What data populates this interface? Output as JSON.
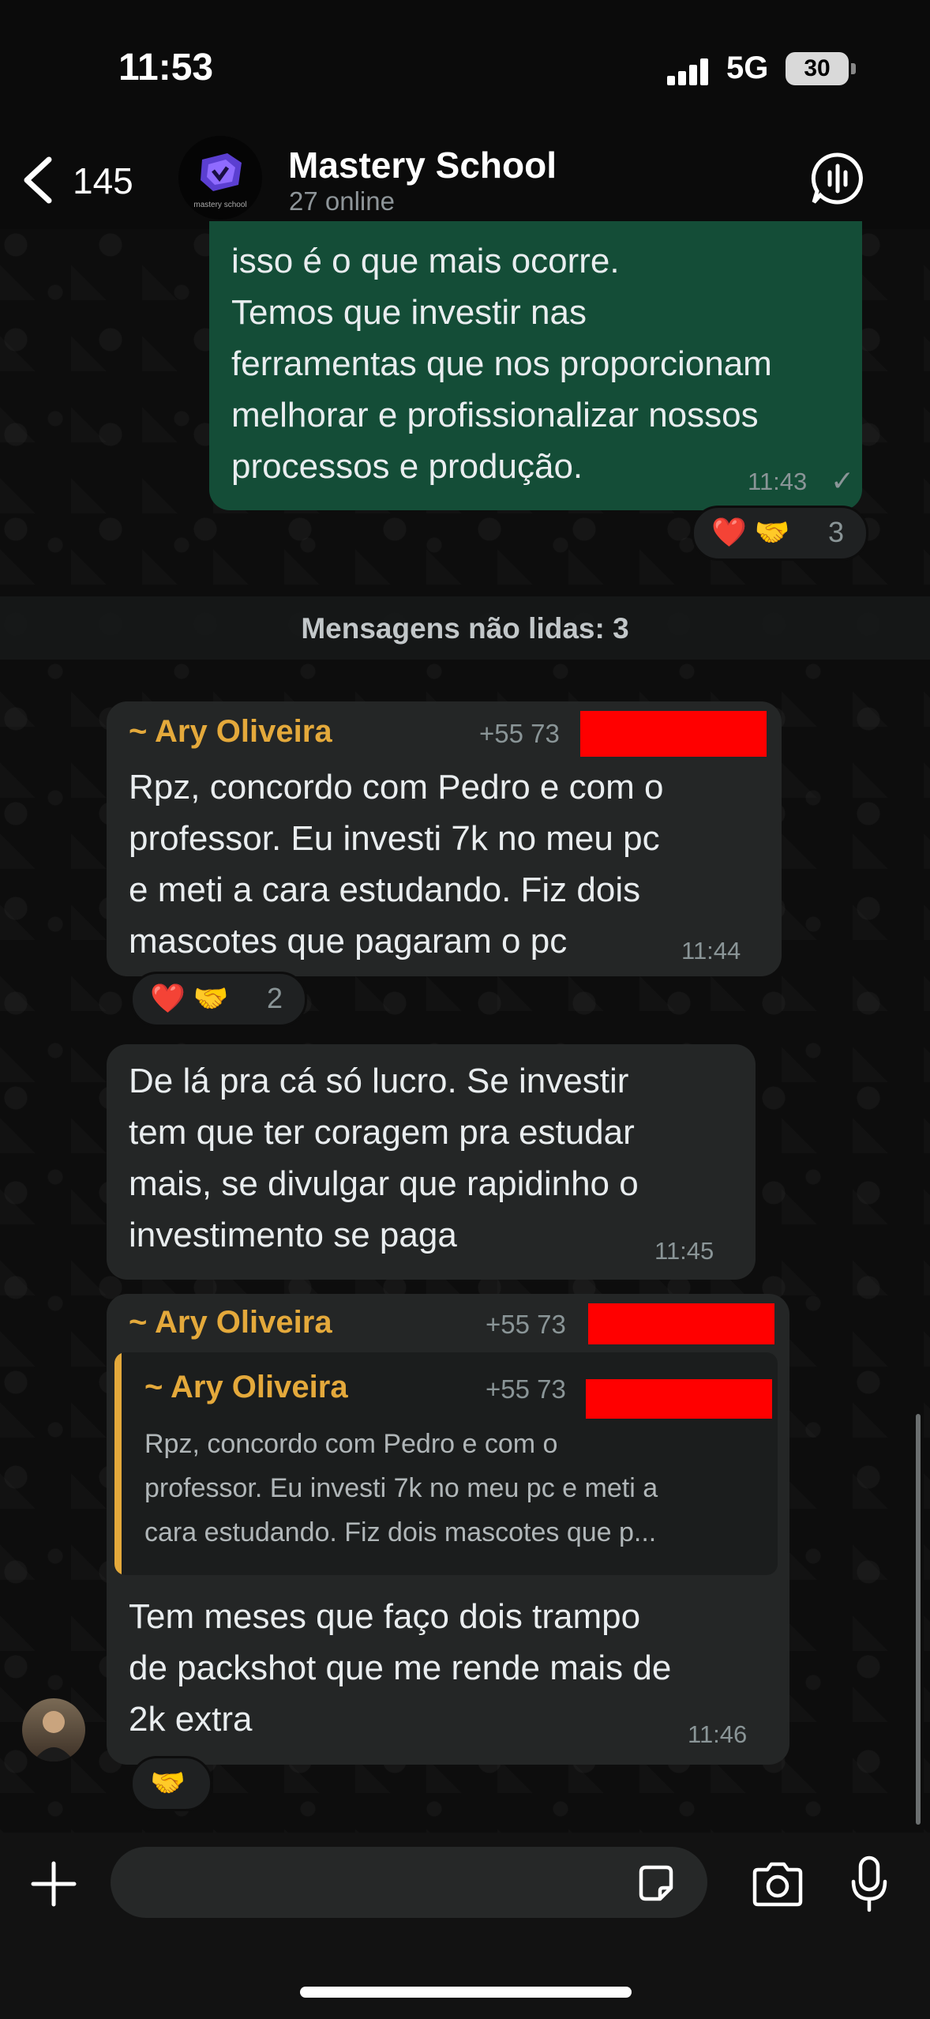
{
  "status_bar": {
    "time": "11:53",
    "network": "5G",
    "battery": "30"
  },
  "header": {
    "back_count": "145",
    "title": "Mastery School",
    "subtitle": "27 online",
    "avatar_text": "mastery school"
  },
  "messages": {
    "m1": {
      "text": "isso é o que mais ocorre.\nTemos que investir nas\nferramentas que nos proporcionam\nmelhorar e profissionalizar nossos\nprocessos e produção.",
      "time": "11:43",
      "status": "✓",
      "reaction": {
        "emojis": "❤️ 🤝",
        "count": "3"
      }
    },
    "unread_label": "Mensagens não lidas: 3",
    "m2": {
      "sender": "~ Ary Oliveira",
      "phone": "+55 73",
      "text": "Rpz, concordo com Pedro e com o\nprofessor. Eu investi 7k no meu pc\ne meti a cara estudando. Fiz dois\nmascotes que pagaram o pc",
      "time": "11:44",
      "reaction": {
        "emojis": "❤️ 🤝",
        "count": "2"
      }
    },
    "m3": {
      "text": "De lá pra cá só lucro. Se investir\ntem que ter coragem pra estudar\nmais, se divulgar que rapidinho o\ninvestimento se paga",
      "time": "11:45"
    },
    "m4": {
      "sender": "~ Ary Oliveira",
      "phone": "+55 73",
      "quote": {
        "sender": "~ Ary Oliveira",
        "phone": "+55 73",
        "text": "Rpz, concordo com Pedro e com o\nprofessor. Eu investi 7k no meu pc e meti a\ncara estudando. Fiz dois mascotes que p..."
      },
      "text": "Tem meses que faço dois trampo\nde packshot que me rende mais de\n2k extra",
      "time": "11:46",
      "reaction": {
        "emojis": "🤝"
      }
    }
  },
  "input": {
    "placeholder": ""
  },
  "colors": {
    "outgoing": "#144d37",
    "incoming": "#242626",
    "sender_name": "#e4a93b",
    "redaction": "#ff0000"
  }
}
